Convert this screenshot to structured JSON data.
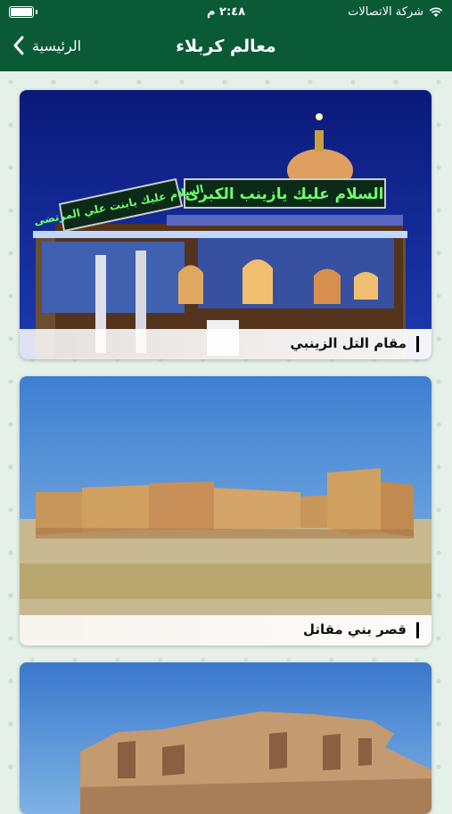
{
  "status": {
    "carrier": "شركة الاتصالات",
    "time": "٢:٤٨ م"
  },
  "nav": {
    "title": "معالم كربلاء",
    "back_label": "الرئيسية"
  },
  "cards": [
    {
      "title": "مقام التل الزينبي",
      "banner1": "السلام عليك يازينب الكبرى",
      "banner2": "السلام عليك يابنت علي المرتضى"
    },
    {
      "title": "قصر بني مقاتل"
    },
    {
      "title": ""
    }
  ],
  "colors": {
    "nav": "#0b5a36",
    "background": "#e4f0e8"
  }
}
